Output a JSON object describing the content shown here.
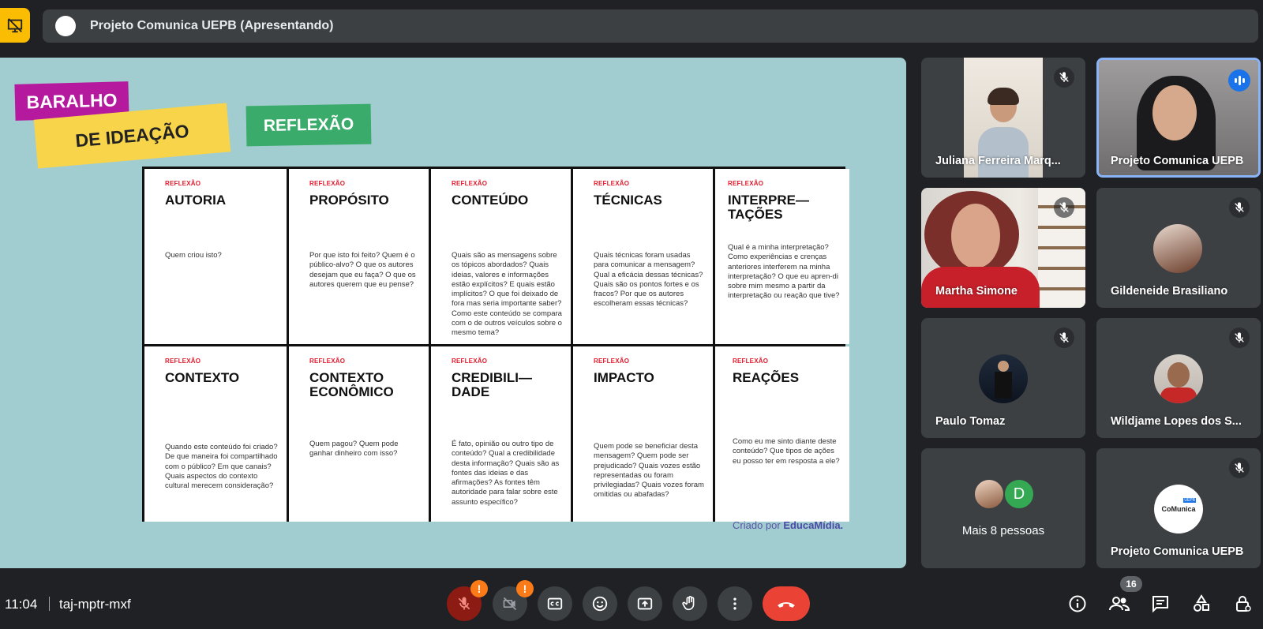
{
  "header": {
    "presenting_title": "Projeto Comunica UEPB (Apresentando)",
    "logo_text": "CoMunica"
  },
  "slide": {
    "tags": {
      "baralho": "BARALHO",
      "ideacao": "DE IDEAÇÃO",
      "reflexao": "REFLEXÃO"
    },
    "cards": [
      {
        "kicker": "REFLEXÃO",
        "title": "AUTORIA",
        "text": "Quem criou isto?"
      },
      {
        "kicker": "REFLEXÃO",
        "title": "PROPÓSITO",
        "text": "Por que isto foi feito? Quem é o público-alvo? O que os autores desejam que eu faça? O que os autores querem que eu pense?"
      },
      {
        "kicker": "REFLEXÃO",
        "title": "CONTEÚDO",
        "text": "Quais são as mensagens sobre os tópicos abordados? Quais ideias, valores e informações estão explícitos? E quais estão implícitos? O que foi deixado de fora mas seria importante saber? Como este conteúdo se compara com o de outros veículos sobre o mesmo tema?"
      },
      {
        "kicker": "REFLEXÃO",
        "title": "TÉCNICAS",
        "text": "Quais técnicas foram usadas para comunicar a mensagem? Qual a eficácia dessas técnicas? Quais são os pontos fortes e os fracos? Por que os autores escolheram essas técnicas?"
      },
      {
        "kicker": "REFLEXÃO",
        "title": "INTERPRE—\nTAÇÕES",
        "text": "Qual é a minha interpretação? Como experiências e crenças anteriores interferem na minha interpretação? O que eu apren-di sobre mim mesmo a partir da interpretação ou reação que tive?"
      },
      {
        "kicker": "REFLEXÃO",
        "title": "CONTEXTO",
        "text": "Quando este conteúdo foi criado? De que maneira foi compartilhado com o público? Em que canais? Quais aspectos do contexto cultural merecem consideração?"
      },
      {
        "kicker": "REFLEXÃO",
        "title": "CONTEXTO\nECONÔMICO",
        "text": "Quem pagou? Quem pode ganhar dinheiro com isso?"
      },
      {
        "kicker": "REFLEXÃO",
        "title": "CREDIBILI—\nDADE",
        "text": "É fato, opinião ou outro tipo de conteúdo? Qual a credibilidade desta informação? Quais são as fontes das ideias e das afirmações? As fontes têm autoridade para falar sobre este assunto específico?"
      },
      {
        "kicker": "REFLEXÃO",
        "title": "IMPACTO",
        "text": "Quem pode se beneficiar desta mensagem? Quem pode ser prejudicado? Quais vozes estão representadas ou foram privilegiadas? Quais vozes foram omitidas ou abafadas?"
      },
      {
        "kicker": "REFLEXÃO",
        "title": "REAÇÕES",
        "text": "Como eu me sinto diante deste conteúdo? Que tipos de ações eu posso ter em resposta a ele?"
      }
    ],
    "credit_prefix": "Criado por ",
    "credit_brand": "EducaMídia."
  },
  "participants": [
    {
      "name": "Juliana Ferreira Marq...",
      "muted": true
    },
    {
      "name": "Projeto Comunica UEPB",
      "speaking": true
    },
    {
      "name": "Martha Simone",
      "muted": true
    },
    {
      "name": "Gildeneide Brasiliano",
      "muted": true
    },
    {
      "name": "Paulo Tomaz",
      "muted": true
    },
    {
      "name": "Wildjame Lopes dos S...",
      "muted": true
    },
    {
      "name": "Mais 8 pessoas",
      "avatar_letter": "D"
    },
    {
      "name": "Projeto Comunica UEPB",
      "muted": true,
      "logo_text": "CoMunica",
      "logo_badge": "UEPB"
    }
  ],
  "bottom": {
    "time": "11:04",
    "meeting_code": "taj-mptr-mxf",
    "alert_mark": "!",
    "people_count": "16"
  },
  "colors": {
    "background": "#202124",
    "tile": "#3c4043",
    "slide_bg": "#a2cdd0",
    "accent_blue": "#1a73e8",
    "hangup_red": "#ea4335",
    "present_yellow": "#fbbc04"
  },
  "icons": [
    "stop-presenting-icon",
    "mic-off-icon",
    "camera-off-icon",
    "captions-icon",
    "emoji-icon",
    "present-icon",
    "raise-hand-icon",
    "more-options-icon",
    "hang-up-icon",
    "info-icon",
    "people-icon",
    "chat-icon",
    "activities-icon",
    "host-controls-icon"
  ]
}
